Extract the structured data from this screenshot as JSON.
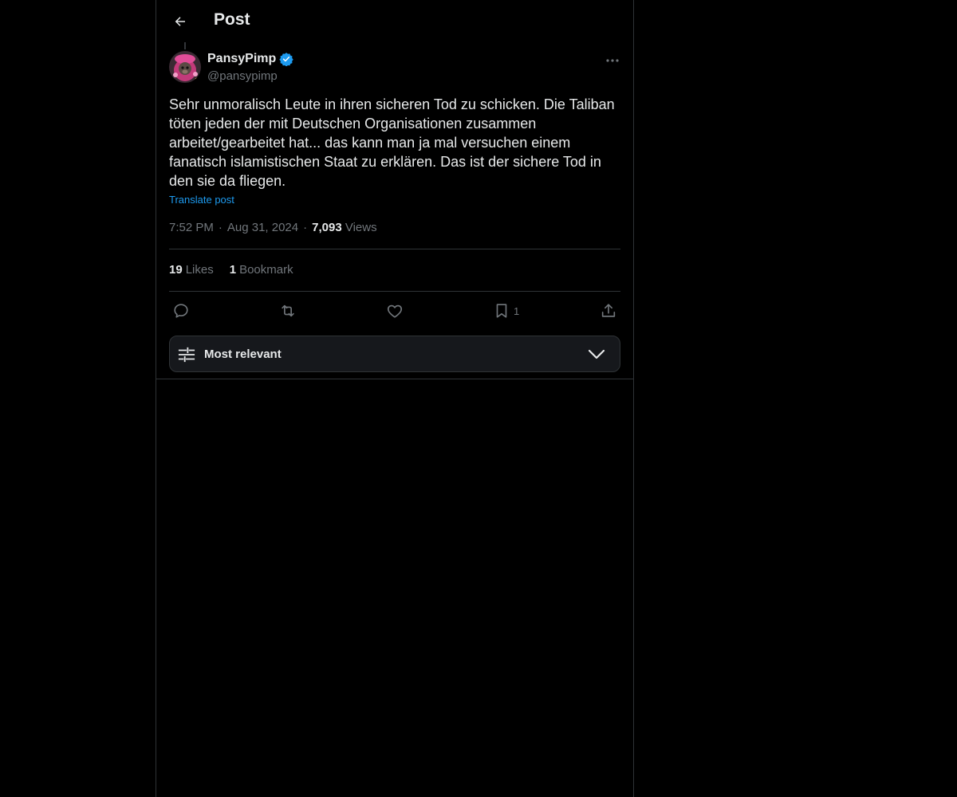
{
  "header": {
    "title": "Post"
  },
  "author": {
    "name": "PansyPimp",
    "handle": "@pansypimp",
    "verified": true
  },
  "post": {
    "text": "Sehr unmoralisch Leute in ihren sicheren Tod zu schicken. Die Taliban töten jeden der mit Deutschen Organisationen zusammen arbeitet/gearbeitet hat... das kann man ja mal versuchen einem fanatisch islamistischen Staat zu erklären. Das ist der sichere Tod in den sie da fliegen.",
    "translate_label": "Translate post",
    "time": "7:52 PM",
    "date": "Aug 31, 2024",
    "views_count": "7,093",
    "views_label": "Views"
  },
  "stats": {
    "likes_count": "19",
    "likes_label": "Likes",
    "bookmarks_count": "1",
    "bookmarks_label": "Bookmark"
  },
  "actions": {
    "bookmark_count": "1"
  },
  "sort": {
    "label": "Most relevant"
  },
  "colors": {
    "accent": "#1d9bf0",
    "muted": "#71767b",
    "border": "#2f3336",
    "background": "#000000"
  },
  "icons": [
    "back-arrow-icon",
    "verified-badge-icon",
    "more-icon",
    "reply-icon",
    "repost-icon",
    "like-icon",
    "bookmark-icon",
    "share-icon",
    "sliders-icon",
    "chevron-down-icon"
  ]
}
